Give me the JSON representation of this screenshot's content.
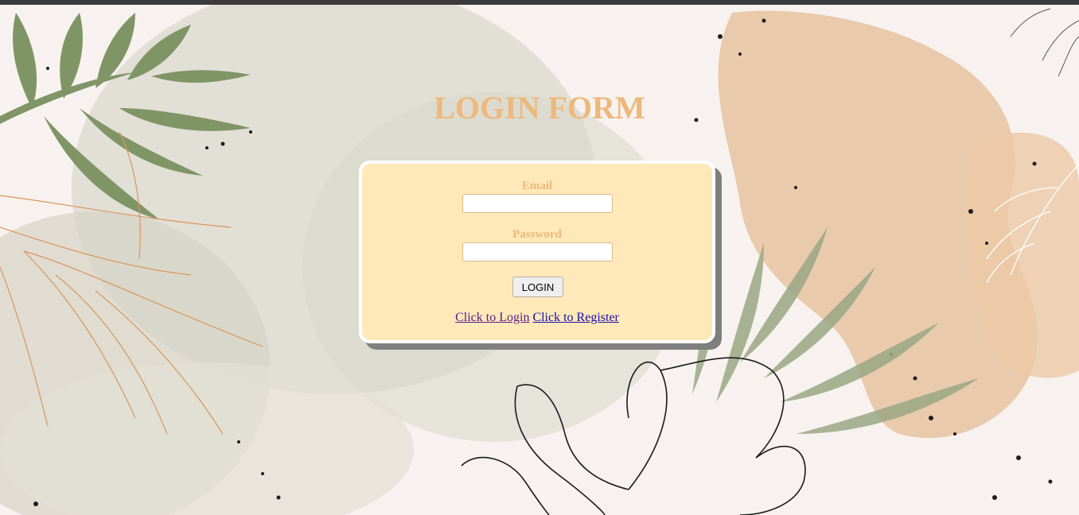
{
  "page": {
    "title": "LOGIN FORM"
  },
  "form": {
    "email_label": "Email",
    "email_value": "",
    "password_label": "Password",
    "password_value": "",
    "login_button": "LOGIN",
    "link_login": "Click to Login",
    "link_register": "Click to Register"
  },
  "colors": {
    "title": "#eeb87a",
    "card_background": "#ffe9b9",
    "card_shadow": "#7f7f7f",
    "leaf_green": "#7f9566",
    "leaf_outline": "#d9955a",
    "peach_blob": "#eac4a1",
    "sage_wash": "#d9d8cc"
  },
  "icons": {
    "background": "watercolor-botanical-background"
  }
}
